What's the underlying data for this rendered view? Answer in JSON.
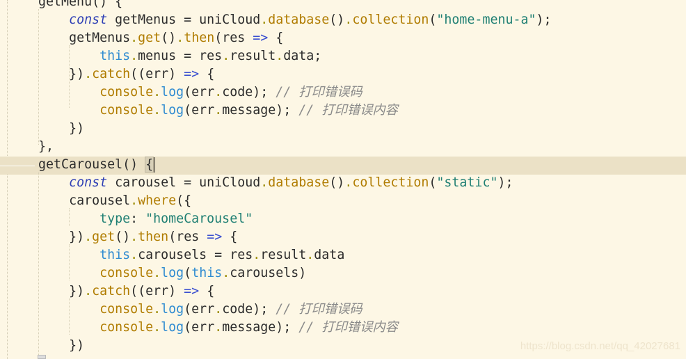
{
  "editor": {
    "lines": [
      {
        "indent": 1,
        "tokens": [
          [
            "plain",
            "getMenu() {"
          ]
        ]
      },
      {
        "indent": 2,
        "tokens": [
          [
            "kw",
            "const"
          ],
          [
            "plain",
            " getMenus = uniCloud"
          ],
          [
            "dot",
            "."
          ],
          [
            "method",
            "database"
          ],
          [
            "plain",
            "()"
          ],
          [
            "dot",
            "."
          ],
          [
            "method",
            "collection"
          ],
          [
            "plain",
            "("
          ],
          [
            "str",
            "\"home-menu-a\""
          ],
          [
            "plain",
            ");"
          ]
        ]
      },
      {
        "indent": 2,
        "tokens": [
          [
            "plain",
            "getMenus"
          ],
          [
            "dot",
            "."
          ],
          [
            "method",
            "get"
          ],
          [
            "plain",
            "()"
          ],
          [
            "dot",
            "."
          ],
          [
            "method",
            "then"
          ],
          [
            "plain",
            "(res "
          ],
          [
            "op",
            "=>"
          ],
          [
            "plain",
            " {"
          ]
        ]
      },
      {
        "indent": 3,
        "tokens": [
          [
            "this",
            "this"
          ],
          [
            "dot",
            "."
          ],
          [
            "plain",
            "menus = res"
          ],
          [
            "dot",
            "."
          ],
          [
            "plain",
            "result"
          ],
          [
            "dot",
            "."
          ],
          [
            "plain",
            "data;"
          ]
        ]
      },
      {
        "indent": 2,
        "tokens": [
          [
            "plain",
            "})"
          ],
          [
            "dot",
            "."
          ],
          [
            "method",
            "catch"
          ],
          [
            "plain",
            "((err) "
          ],
          [
            "op",
            "=>"
          ],
          [
            "plain",
            " {"
          ]
        ]
      },
      {
        "indent": 3,
        "tokens": [
          [
            "method",
            "console"
          ],
          [
            "dot",
            "."
          ],
          [
            "this",
            "log"
          ],
          [
            "plain",
            "(err"
          ],
          [
            "dot",
            "."
          ],
          [
            "plain",
            "code); "
          ],
          [
            "comment",
            "// 打印错误码"
          ]
        ]
      },
      {
        "indent": 3,
        "tokens": [
          [
            "method",
            "console"
          ],
          [
            "dot",
            "."
          ],
          [
            "this",
            "log"
          ],
          [
            "plain",
            "(err"
          ],
          [
            "dot",
            "."
          ],
          [
            "plain",
            "message); "
          ],
          [
            "comment",
            "// 打印错误内容"
          ]
        ]
      },
      {
        "indent": 2,
        "tokens": [
          [
            "plain",
            "})"
          ]
        ]
      },
      {
        "indent": 1,
        "tokens": [
          [
            "plain",
            "},"
          ]
        ]
      },
      {
        "indent": 1,
        "tokens": [
          [
            "plain",
            "getCarousel() "
          ],
          [
            "brace",
            "{"
          ]
        ]
      },
      {
        "indent": 2,
        "tokens": [
          [
            "kw",
            "const"
          ],
          [
            "plain",
            " carousel = uniCloud"
          ],
          [
            "dot",
            "."
          ],
          [
            "method",
            "database"
          ],
          [
            "plain",
            "()"
          ],
          [
            "dot",
            "."
          ],
          [
            "method",
            "collection"
          ],
          [
            "plain",
            "("
          ],
          [
            "str",
            "\"static\""
          ],
          [
            "plain",
            ");"
          ]
        ]
      },
      {
        "indent": 2,
        "tokens": [
          [
            "plain",
            "carousel"
          ],
          [
            "dot",
            "."
          ],
          [
            "method",
            "where"
          ],
          [
            "plain",
            "({"
          ]
        ]
      },
      {
        "indent": 3,
        "tokens": [
          [
            "str",
            "type"
          ],
          [
            "plain",
            ": "
          ],
          [
            "str",
            "\"homeCarousel\""
          ]
        ]
      },
      {
        "indent": 2,
        "tokens": [
          [
            "plain",
            "})"
          ],
          [
            "dot",
            "."
          ],
          [
            "method",
            "get"
          ],
          [
            "plain",
            "()"
          ],
          [
            "dot",
            "."
          ],
          [
            "method",
            "then"
          ],
          [
            "plain",
            "(res "
          ],
          [
            "op",
            "=>"
          ],
          [
            "plain",
            " {"
          ]
        ]
      },
      {
        "indent": 3,
        "tokens": [
          [
            "this",
            "this"
          ],
          [
            "dot",
            "."
          ],
          [
            "plain",
            "carousels = res"
          ],
          [
            "dot",
            "."
          ],
          [
            "plain",
            "result"
          ],
          [
            "dot",
            "."
          ],
          [
            "plain",
            "data"
          ]
        ]
      },
      {
        "indent": 3,
        "tokens": [
          [
            "method",
            "console"
          ],
          [
            "dot",
            "."
          ],
          [
            "this",
            "log"
          ],
          [
            "plain",
            "("
          ],
          [
            "this",
            "this"
          ],
          [
            "dot",
            "."
          ],
          [
            "plain",
            "carousels)"
          ]
        ]
      },
      {
        "indent": 2,
        "tokens": [
          [
            "plain",
            "})"
          ],
          [
            "dot",
            "."
          ],
          [
            "method",
            "catch"
          ],
          [
            "plain",
            "((err) "
          ],
          [
            "op",
            "=>"
          ],
          [
            "plain",
            " {"
          ]
        ]
      },
      {
        "indent": 3,
        "tokens": [
          [
            "method",
            "console"
          ],
          [
            "dot",
            "."
          ],
          [
            "this",
            "log"
          ],
          [
            "plain",
            "(err"
          ],
          [
            "dot",
            "."
          ],
          [
            "plain",
            "code); "
          ],
          [
            "comment",
            "// 打印错误码"
          ]
        ]
      },
      {
        "indent": 3,
        "tokens": [
          [
            "method",
            "console"
          ],
          [
            "dot",
            "."
          ],
          [
            "this",
            "log"
          ],
          [
            "plain",
            "(err"
          ],
          [
            "dot",
            "."
          ],
          [
            "plain",
            "message); "
          ],
          [
            "comment",
            "// 打印错误内容"
          ]
        ]
      },
      {
        "indent": 2,
        "tokens": [
          [
            "plain",
            "})"
          ]
        ]
      }
    ],
    "current_line": 9
  },
  "watermark": "https://blog.csdn.net/qq_42027681"
}
